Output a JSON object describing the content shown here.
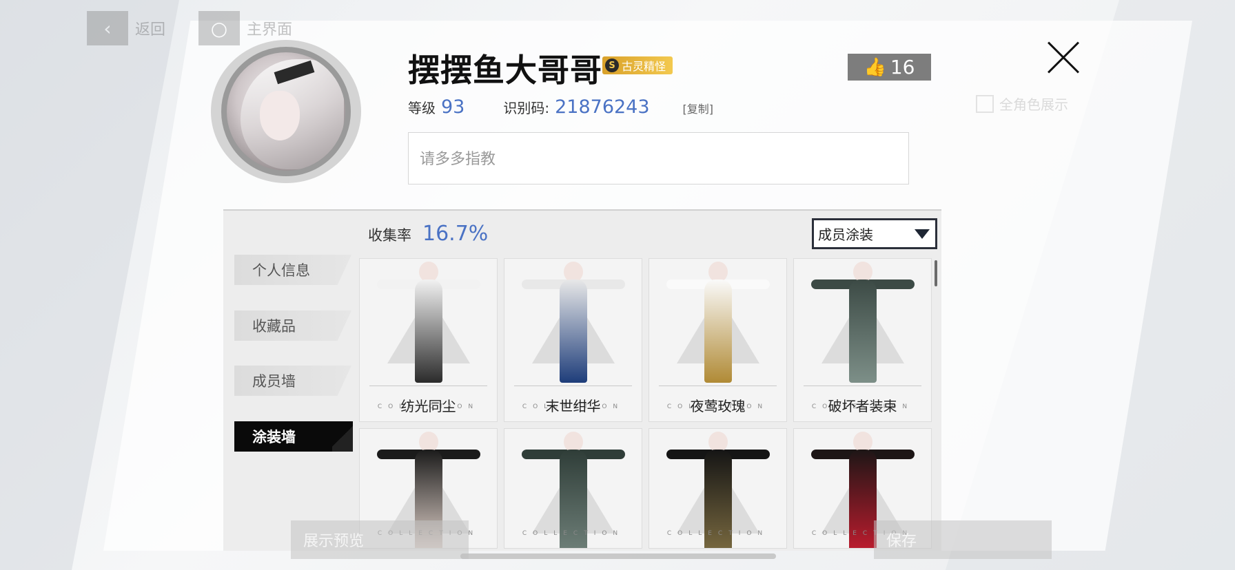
{
  "nav": {
    "back_label": "返回",
    "home_label": "主界面",
    "show_all_label": "全角色展示"
  },
  "profile": {
    "username": "摆摆鱼大哥哥",
    "title_badge": {
      "icon_letter": "S",
      "text": "古灵精怪"
    },
    "likes": "16",
    "level_label": "等级",
    "level": "93",
    "uid_label": "识别码:",
    "uid": "21876243",
    "copy_label": "[复制]",
    "signature": "请多多指教"
  },
  "collection": {
    "rate_label": "收集率",
    "rate_value": "16.7%",
    "filter_selected": "成员涂装",
    "sidebar": [
      {
        "label": "个人信息",
        "active": false
      },
      {
        "label": "收藏品",
        "active": false
      },
      {
        "label": "成员墙",
        "active": false
      },
      {
        "label": "涂装墙",
        "active": true
      }
    ],
    "watermark": "COLLECTION",
    "items": [
      {
        "name": "纺光同尘",
        "outfit_color": "#f2f2f2",
        "accent": "#2b2b2b"
      },
      {
        "name": "末世绀华",
        "outfit_color": "#e8e8e8",
        "accent": "#1e3d7a"
      },
      {
        "name": "夜莺玫瑰",
        "outfit_color": "#fafafa",
        "accent": "#b08a35"
      },
      {
        "name": "破坏者装束",
        "outfit_color": "#3c4a45",
        "accent": "#7d8f88"
      },
      {
        "name": "",
        "outfit_color": "#1b1b1b",
        "accent": "#e6d7cf"
      },
      {
        "name": "",
        "outfit_color": "#2f3d38",
        "accent": "#6f8079"
      },
      {
        "name": "",
        "outfit_color": "#151515",
        "accent": "#7a6a40"
      },
      {
        "name": "",
        "outfit_color": "#1d1616",
        "accent": "#c01c2e"
      }
    ]
  },
  "bottom": {
    "preview_label": "展示预览",
    "save_label": "保存"
  }
}
